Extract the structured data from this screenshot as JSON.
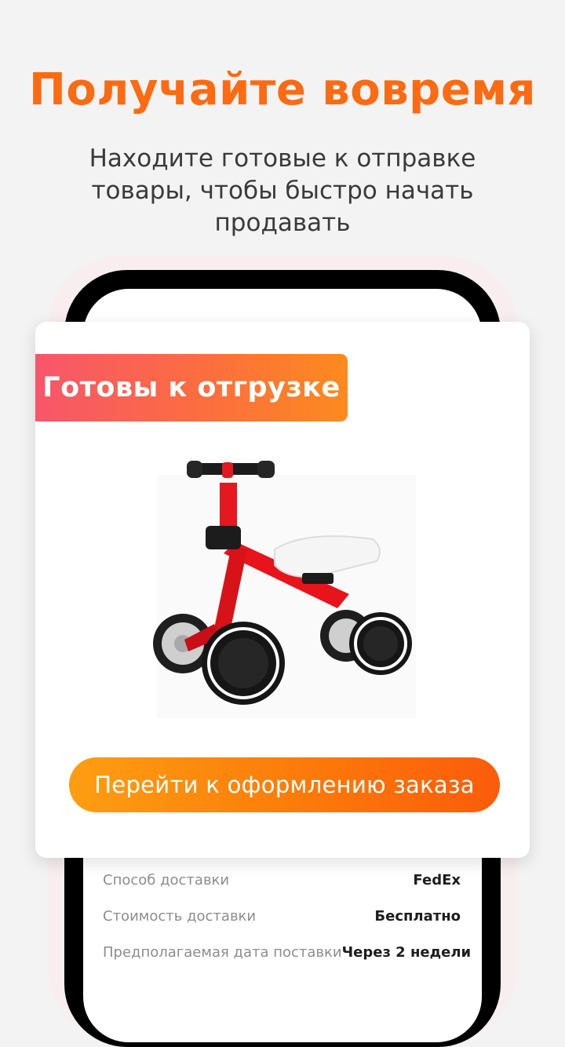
{
  "headline": "Получайте вовремя",
  "subtitle": "Находите готовые к отправке товары, чтобы быстро начать продавать",
  "card": {
    "badge": "Готовы к отгрузке",
    "product_image": "red-balance-bike",
    "cta_label": "Перейти к оформлению заказа"
  },
  "shipping": {
    "rows": [
      {
        "label": "Способ доставки",
        "value": "FedEx"
      },
      {
        "label": "Стоимость доставки",
        "value": "Бесплатно"
      },
      {
        "label": "Предполагаемая дата поставки",
        "value": "Через 2 недели"
      }
    ]
  },
  "colors": {
    "accent": "#fb6b13",
    "badge_gradient_start": "#f7566a",
    "badge_gradient_end": "#fd8a1e",
    "cta_gradient_start": "#fd9e12",
    "cta_gradient_end": "#fb5c0a"
  }
}
